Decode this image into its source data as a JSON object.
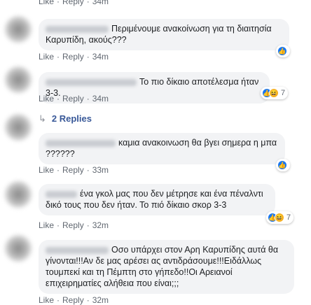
{
  "top_actions": {
    "like": "Like",
    "reply": "Reply",
    "time": "34m"
  },
  "comments": [
    {
      "text": "Περιμένουμε ανακοίνωση για τη διαιτησία Καρυπίδη, ακούς???",
      "like": "Like",
      "reply": "Reply",
      "time": "34m",
      "reactions": {
        "types": [
          "like"
        ],
        "count": ""
      }
    },
    {
      "text": "Το πιο δίκαιο αποτέλεσμα ήταν 3-3.",
      "like": "Like",
      "reply": "Reply",
      "time": "34m",
      "reactions": {
        "types": [
          "like",
          "haha"
        ],
        "count": "7"
      }
    },
    {
      "text": "καμια ανακοινωση θα βγει σημερα η μπα ??????",
      "like": "Like",
      "reply": "Reply",
      "time": "33m",
      "reactions": {
        "types": [
          "like"
        ],
        "count": ""
      }
    },
    {
      "text": "ένα γκολ μας που δεν μέτρησε και ένα πέναλντι δικό τους που δεν ήταν. Το πιό δίκαιο σκορ 3-3",
      "like": "Like",
      "reply": "Reply",
      "time": "32m",
      "reactions": {
        "types": [
          "like",
          "haha"
        ],
        "count": "7"
      }
    },
    {
      "text": "Οσο υπάρχει στον Αρη Καρυπίδης αυτά θα γίνονται!!!Αν δε μας αρέσει ας αντιδράσουμε!!!Ειδάλλως τουμπεκί και τη Πέμπτη στο γήπεδο!!Οι Αρειανοί επιχειρηματίες αλήθεια που είναι;;;",
      "like": "Like",
      "reply": "Reply",
      "time": "32m",
      "reactions": {
        "types": [],
        "count": ""
      }
    }
  ],
  "replies_link": {
    "label": "2 Replies",
    "arrow": "↳"
  },
  "colors": {
    "link": "#385898",
    "bubble": "#f2f3f5",
    "meta": "#606770",
    "like": "#1877f2",
    "haha": "#f7b125"
  }
}
